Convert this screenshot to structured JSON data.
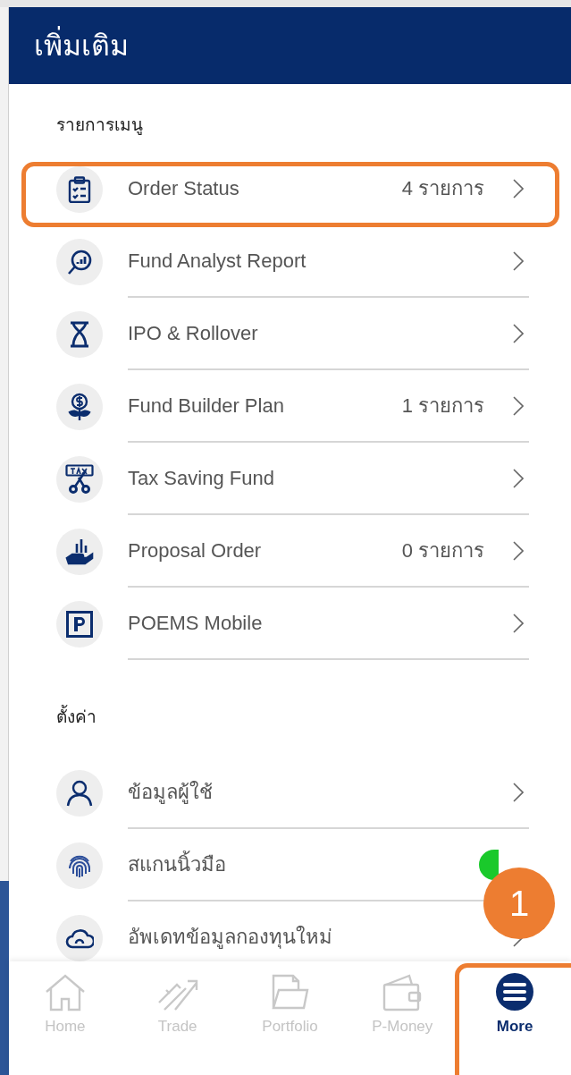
{
  "header": {
    "title": "เพิ่มเติม"
  },
  "sections": [
    {
      "title": "รายการเมนู",
      "items": [
        {
          "kind": "link",
          "label": "Order Status",
          "count": "4 รายการ",
          "highlighted": true
        },
        {
          "kind": "link",
          "label": "Fund Analyst Report",
          "highlighted": false
        },
        {
          "kind": "link",
          "label": "IPO & Rollover",
          "highlighted": false
        },
        {
          "kind": "link",
          "label": "Fund Builder Plan",
          "count": "1 รายการ",
          "highlighted": false
        },
        {
          "kind": "link",
          "label": "Tax Saving Fund",
          "highlighted": false
        },
        {
          "kind": "link",
          "label": "Proposal Order",
          "count": "0 รายการ",
          "highlighted": false
        },
        {
          "kind": "link",
          "label": "POEMS Mobile",
          "highlighted": false
        }
      ]
    },
    {
      "title": "ตั้งค่า",
      "items": [
        {
          "kind": "link",
          "label": "ข้อมูลผู้ใช้",
          "highlighted": false
        },
        {
          "kind": "toggle",
          "label": "สแกนนิ้วมือ",
          "on": true
        },
        {
          "kind": "link",
          "label": "อัพเดทข้อมูลกองทุนใหม่",
          "highlighted": false
        }
      ]
    }
  ],
  "nav": [
    {
      "label": "Home",
      "selected": false,
      "highlighted": false
    },
    {
      "label": "Trade",
      "selected": false,
      "highlighted": false
    },
    {
      "label": "Portfolio",
      "selected": false,
      "highlighted": false
    },
    {
      "label": "P-Money",
      "selected": false,
      "highlighted": false
    },
    {
      "label": "More",
      "selected": true,
      "highlighted": true
    }
  ],
  "annotation": {
    "badge": "1"
  }
}
